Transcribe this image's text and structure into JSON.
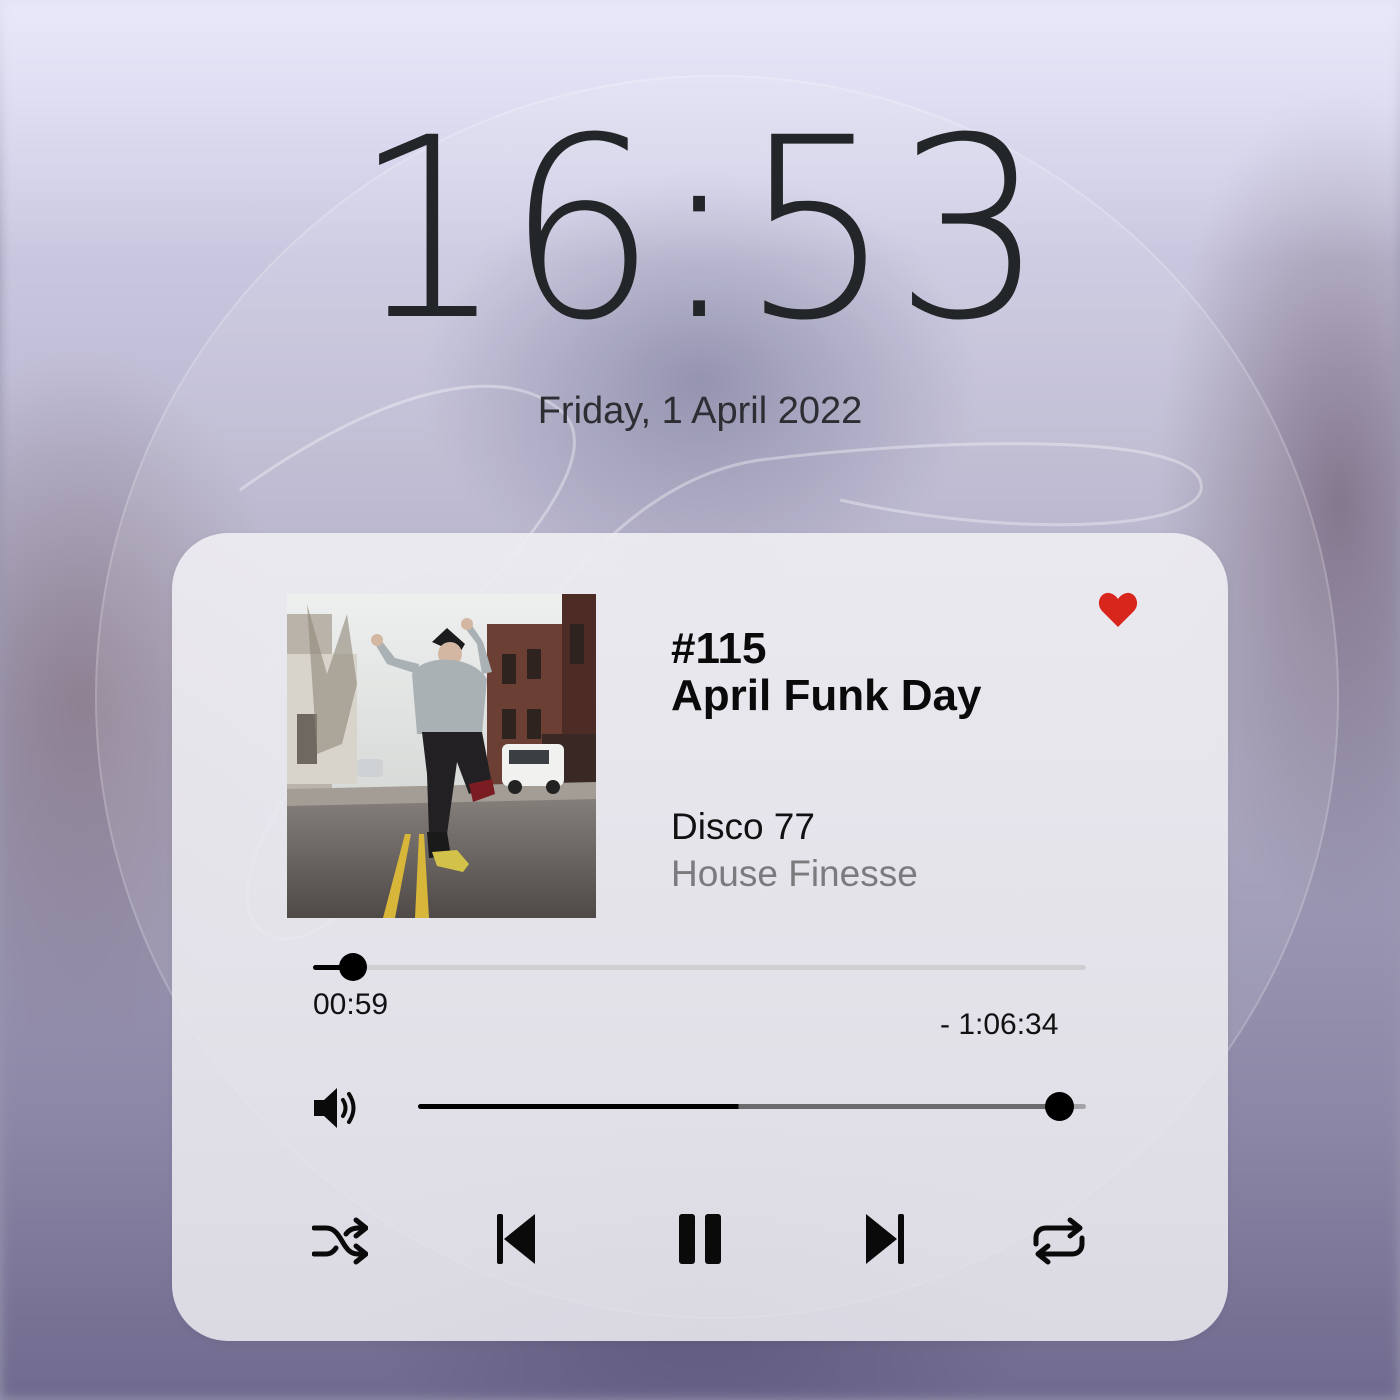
{
  "lockscreen": {
    "time": "16:53",
    "date": "Friday, 1 April 2022"
  },
  "player": {
    "episode_number": "#115",
    "track_title": "April Funk Day",
    "artist": "Disco 77",
    "album": "House Finesse",
    "liked": true,
    "elapsed": "00:59",
    "remaining": "- 1:06:34",
    "progress_fraction": 0.052,
    "volume_fraction": 0.96,
    "controls": {
      "shuffle_icon": "shuffle-icon",
      "previous_icon": "skip-back-icon",
      "pause_icon": "pause-icon",
      "next_icon": "skip-forward-icon",
      "repeat_icon": "repeat-icon",
      "volume_icon": "speaker-volume-icon",
      "heart_icon": "heart-icon"
    },
    "colors": {
      "accent_heart": "#d9261c",
      "primary_text": "#0a0a0a",
      "secondary_text": "#7b7b7d",
      "clock_text": "#222629"
    }
  }
}
